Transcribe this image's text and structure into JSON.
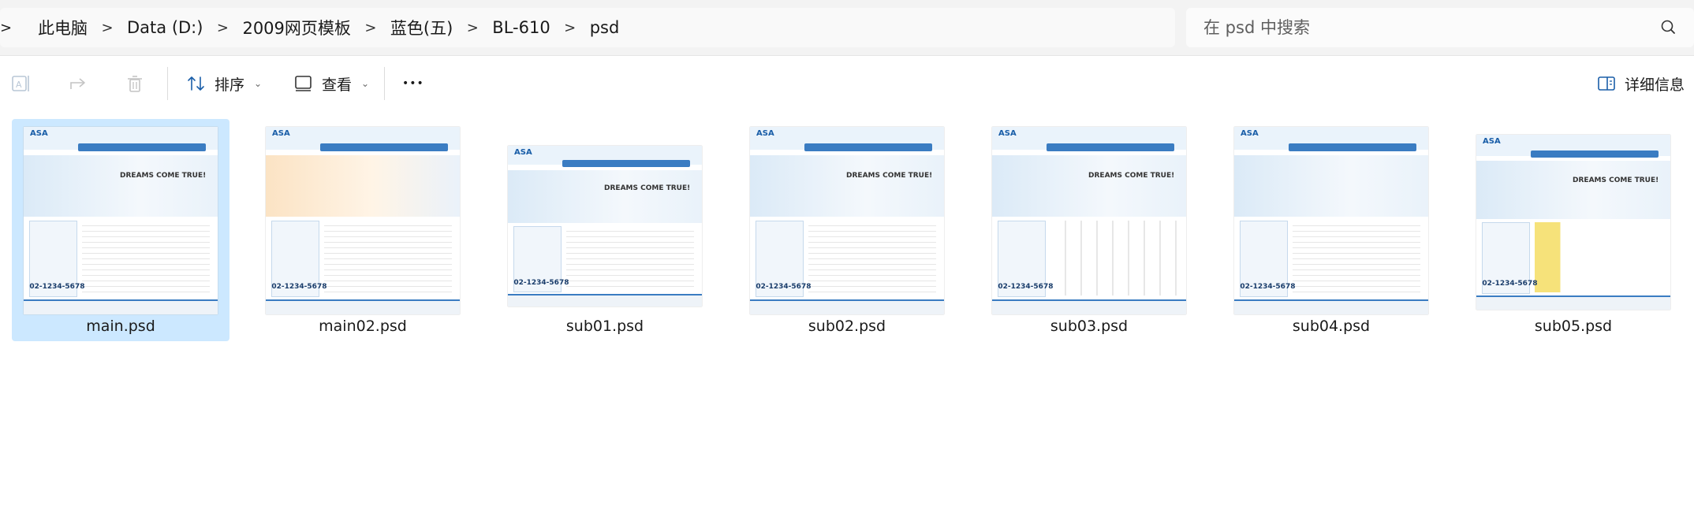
{
  "breadcrumb": {
    "lead_chevron": ">",
    "items": [
      "此电脑",
      "Data (D:)",
      "2009网页模板",
      "蓝色(五)",
      "BL-610",
      "psd"
    ],
    "separator": ">"
  },
  "search": {
    "placeholder": "在 psd 中搜索",
    "icon": "search-icon"
  },
  "toolbar": {
    "rename_icon": "rename-icon",
    "share_icon": "share-icon",
    "delete_icon": "trash-icon",
    "sort_label": "排序",
    "view_label": "查看",
    "more_label": "•••",
    "details_label": "详细信息"
  },
  "files": [
    {
      "name": "main.psd",
      "selected": true
    },
    {
      "name": "main02.psd",
      "selected": false
    },
    {
      "name": "sub01.psd",
      "selected": false
    },
    {
      "name": "sub02.psd",
      "selected": false
    },
    {
      "name": "sub03.psd",
      "selected": false
    },
    {
      "name": "sub04.psd",
      "selected": false
    },
    {
      "name": "sub05.psd",
      "selected": false
    }
  ],
  "thumb_text": {
    "logo": "ASA",
    "banner": "DREAMS COME TRUE!",
    "phone": "02-1234-5678"
  },
  "colors": {
    "selected_bg": "#cce8ff",
    "accent": "#3a7cc2"
  }
}
